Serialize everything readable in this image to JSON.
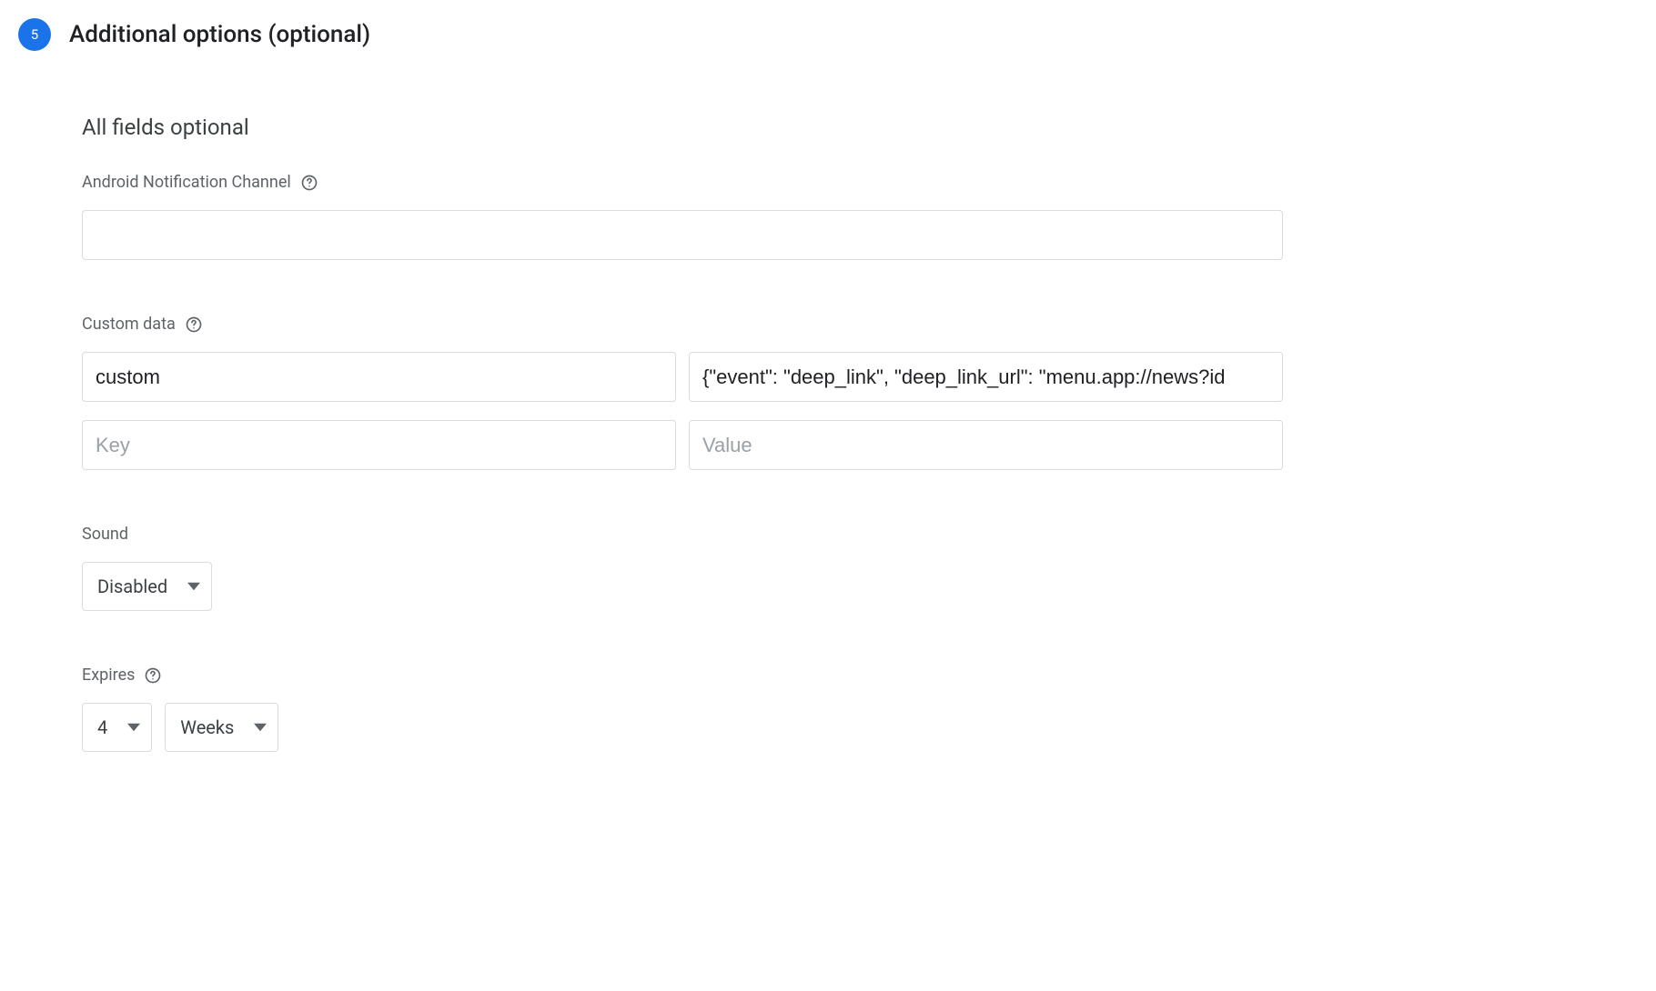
{
  "step": {
    "number": "5",
    "title": "Additional options (optional)"
  },
  "subtitle": "All fields optional",
  "android_channel": {
    "label": "Android Notification Channel",
    "value": ""
  },
  "custom_data": {
    "label": "Custom data",
    "rows": [
      {
        "key": "custom",
        "value": "{\"event\": \"deep_link\", \"deep_link_url\": \"menu.app://news?id"
      },
      {
        "key": "",
        "value": ""
      }
    ],
    "key_placeholder": "Key",
    "value_placeholder": "Value"
  },
  "sound": {
    "label": "Sound",
    "selected": "Disabled"
  },
  "expires": {
    "label": "Expires",
    "amount": "4",
    "unit": "Weeks"
  }
}
